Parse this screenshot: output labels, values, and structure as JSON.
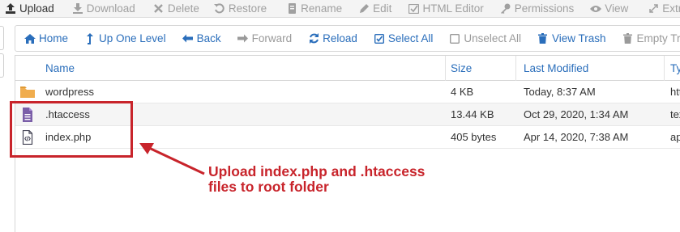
{
  "toolbar": {
    "items": [
      {
        "label": "Upload",
        "icon": "upload-icon",
        "enabled": true
      },
      {
        "label": "Download",
        "icon": "download-icon",
        "enabled": false
      },
      {
        "label": "Delete",
        "icon": "delete-icon",
        "enabled": false
      },
      {
        "label": "Restore",
        "icon": "restore-icon",
        "enabled": false
      },
      {
        "label": "Rename",
        "icon": "rename-icon",
        "enabled": false
      },
      {
        "label": "Edit",
        "icon": "edit-icon",
        "enabled": false
      },
      {
        "label": "HTML Editor",
        "icon": "html-editor-icon",
        "enabled": false
      },
      {
        "label": "Permissions",
        "icon": "permissions-icon",
        "enabled": false
      },
      {
        "label": "View",
        "icon": "view-icon",
        "enabled": false
      },
      {
        "label": "Extra",
        "icon": "extract-icon",
        "enabled": false
      }
    ]
  },
  "navbar": {
    "home": "Home",
    "up_one_level": "Up One Level",
    "back": "Back",
    "forward": "Forward",
    "reload": "Reload",
    "select_all": "Select All",
    "unselect_all": "Unselect All",
    "view_trash": "View Trash",
    "empty_trash": "Empty Trash"
  },
  "table": {
    "columns": {
      "name": "Name",
      "size": "Size",
      "last_modified": "Last Modified",
      "type": "Ty"
    },
    "rows": [
      {
        "name": "wordpress",
        "size": "4 KB",
        "last_modified": "Today, 8:37 AM",
        "type": "htt",
        "icon": "folder-icon"
      },
      {
        "name": ".htaccess",
        "size": "13.44 KB",
        "last_modified": "Oct 29, 2020, 1:34 AM",
        "type": "tex",
        "icon": "text-file-icon"
      },
      {
        "name": "index.php",
        "size": "405 bytes",
        "last_modified": "Apr 14, 2020, 7:38 AM",
        "type": "ap",
        "icon": "code-file-icon"
      }
    ]
  },
  "annotation": {
    "line1": "Upload index.php and .htaccess",
    "line2": "files to root folder",
    "color": "#c8242b"
  },
  "colors": {
    "link": "#2a6ebb",
    "folder": "#f0ad4e",
    "text_file": "#7a5ea8",
    "annotation": "#c8242b"
  }
}
